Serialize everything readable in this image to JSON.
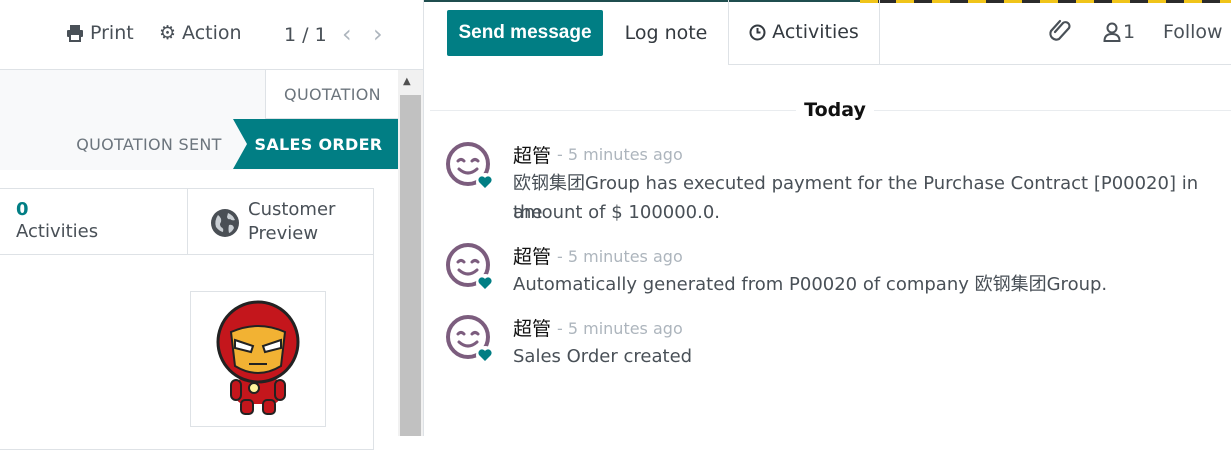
{
  "toolbar": {
    "print_label": "Print",
    "action_label": "Action",
    "pager_value": "1 / 1"
  },
  "statusbar": {
    "stages": [
      "QUOTATION",
      "QUOTATION SENT",
      "SALES ORDER"
    ],
    "active_stage": "SALES ORDER"
  },
  "smart_buttons": {
    "activities_count": "0",
    "activities_label": "Activities",
    "preview_label_1": "Customer",
    "preview_label_2": "Preview"
  },
  "chatter": {
    "send_message_label": "Send message",
    "log_note_label": "Log note",
    "activities_label": "Activities",
    "followers_count": "1",
    "follow_label": "Follow",
    "date_separator": "Today",
    "messages": [
      {
        "author": "超管",
        "date": "- 5 minutes ago",
        "body_line1": "欧钢集团Group has executed payment for the Purchase Contract [P00020] in the",
        "body_line2": "amount of $ 100000.0."
      },
      {
        "author": "超管",
        "date": "- 5 minutes ago",
        "body_line1": "Automatically generated from P00020 of company 欧钢集团Group."
      },
      {
        "author": "超管",
        "date": "- 5 minutes ago",
        "body_line1": "Sales Order created"
      }
    ]
  },
  "colors": {
    "brand": "#017e84",
    "avatar_purple": "#7c5d7e"
  },
  "icons": [
    "print-icon",
    "gear-icon",
    "chevron-left-icon",
    "chevron-right-icon",
    "globe-icon",
    "clock-icon",
    "paperclip-icon",
    "user-icon",
    "heart-icon"
  ]
}
